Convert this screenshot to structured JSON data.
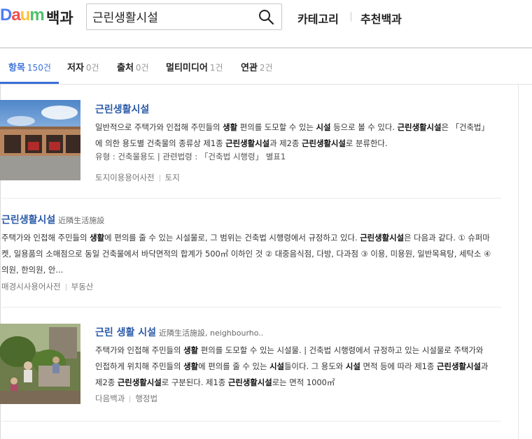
{
  "header": {
    "logo_text": "DAUM",
    "logo_sub": "백과",
    "search_value": "근린생활시설",
    "nav": [
      "카테고리",
      "추천백과"
    ]
  },
  "tabs": [
    {
      "label": "항목",
      "count": "150건"
    },
    {
      "label": "저자",
      "count": "0건"
    },
    {
      "label": "출처",
      "count": "0건"
    },
    {
      "label": "멀티미디어",
      "count": "1건"
    },
    {
      "label": "연관",
      "count": "2건"
    }
  ],
  "results": [
    {
      "title": "근린생활시설",
      "desc": "일반적으로 주택가와 인접해 주민들의 <b>생활</b> 편의를 도모할 수 있는 <b>시설</b> 등으로 볼 수 있다. <b>근린생활시설</b>은 「건축법」에 의한 용도별 건축물의 종류상 제1종 <b>근린생활시설</b>과 제2종 <b>근린생활시설</b>로 분류한다.",
      "meta": "유형 : 건축물용도   |   관련법령 : 「건축법 시행령」 별표1",
      "source": [
        "토지이용용어사전",
        "토지"
      ]
    },
    {
      "title": "근린생활시설",
      "hanja": "近隣生活施設",
      "desc": "주택가와 인접해 주민들의 <b>생활</b>에 편의를 줄 수 있는 시설물로, 그 범위는 건축법 시행령에서 규정하고 있다. <b>근린생활시설</b>은 다음과 같다. ① 슈퍼마켓, 일용품의 소매점으로 동일 건축물에서 바닥면적의 합계가 500㎡ 이하인 것 ② 대중음식점, 다방, 다과점 ③ 이용, 미용원, 일반목욕탕, 세탁소 ④ 의원, 한의원, 안...",
      "source": [
        "매경시사용어사전",
        "부동산"
      ]
    },
    {
      "title": "근린 생활 시설",
      "hanja": "近隣生活施設, neighbourho..",
      "desc": "주택가와 인접해 주민들의 <b>생활</b> 편의를 도모할 수 있는 시설물. | 건축법 시행령에서 규정하고 있는 시설물로 주택가와 인접하게 위치해 주민들의 <b>생활</b>에 편의를 줄 수 있는 <b>시설</b>들이다. 그 용도와 <b>시설</b> 면적 등에 따라 제1종 <b>근린생활시설</b>과 제2종 <b>근린생활시설</b>로 구분된다. 제1종 <b>근린생활시설</b>로는 면적 1000㎡",
      "source": [
        "다음백과",
        "행정법"
      ]
    }
  ],
  "colors": {
    "accent": "#3a6fd8",
    "title_link": "#2a5aa8"
  },
  "icons": {
    "search": "search-icon"
  }
}
